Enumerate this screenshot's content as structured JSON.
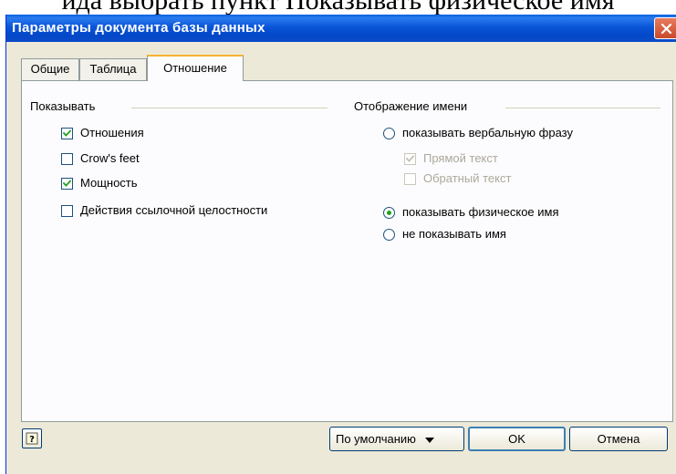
{
  "document_text": "ида выбрать пункт Показывать физическое имя",
  "window": {
    "title": "Параметры документа базы данных"
  },
  "tabs": [
    {
      "label": "Общие",
      "active": false
    },
    {
      "label": "Таблица",
      "active": false
    },
    {
      "label": "Отношение",
      "active": true
    }
  ],
  "show_group": {
    "label": "Показывать",
    "items": [
      {
        "label": "Отношения",
        "checked": true
      },
      {
        "label": "Crow's feet",
        "checked": false
      },
      {
        "label": "Мощность",
        "checked": true
      },
      {
        "label": "Действия ссылочной целостности",
        "checked": false
      }
    ]
  },
  "name_group": {
    "label": "Отображение имени",
    "verbal": {
      "label": "показывать вербальную фразу",
      "selected": false
    },
    "direct_text": {
      "label": "Прямой текст",
      "checked": true,
      "disabled": true
    },
    "reverse_text": {
      "label": "Обратный текст",
      "checked": false,
      "disabled": true
    },
    "physical": {
      "label": "показывать физическое имя",
      "selected": true
    },
    "none": {
      "label": "не показывать имя",
      "selected": false
    }
  },
  "buttons": {
    "default_label": "По умолчанию",
    "ok_label": "OK",
    "cancel_label": "Отмена"
  },
  "colors": {
    "title_bar": "#0a55d8",
    "dialog_bg": "#ece9d8",
    "radio_dot": "#21a121",
    "tab_highlight": "#f7b332"
  }
}
